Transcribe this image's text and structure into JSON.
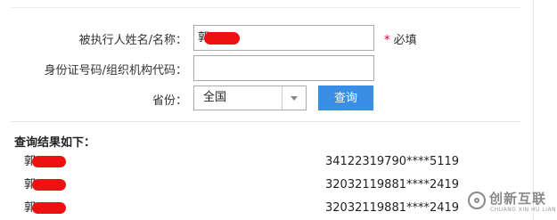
{
  "form": {
    "name_label": "被执行人姓名/名称：",
    "name_value": "郭",
    "required_star": "*",
    "required_text": "必填",
    "id_label": "身份证号码/组织机构代码：",
    "id_value": "",
    "province_label": "省份：",
    "province_value": "全国",
    "query_label": "查询"
  },
  "results": {
    "title": "查询结果如下：",
    "rows": [
      {
        "name": "郭",
        "id": "34122319790****5119"
      },
      {
        "name": "郭",
        "id": "32032119881****2419"
      },
      {
        "name": "郭",
        "id": "32032119881****2419"
      }
    ]
  },
  "watermark": {
    "text": "创新互联",
    "subtext": "CHUANG XIN HU LIAN"
  },
  "colors": {
    "accent": "#3a8ee6",
    "required": "#e0002a",
    "redaction": "#ee1111"
  }
}
